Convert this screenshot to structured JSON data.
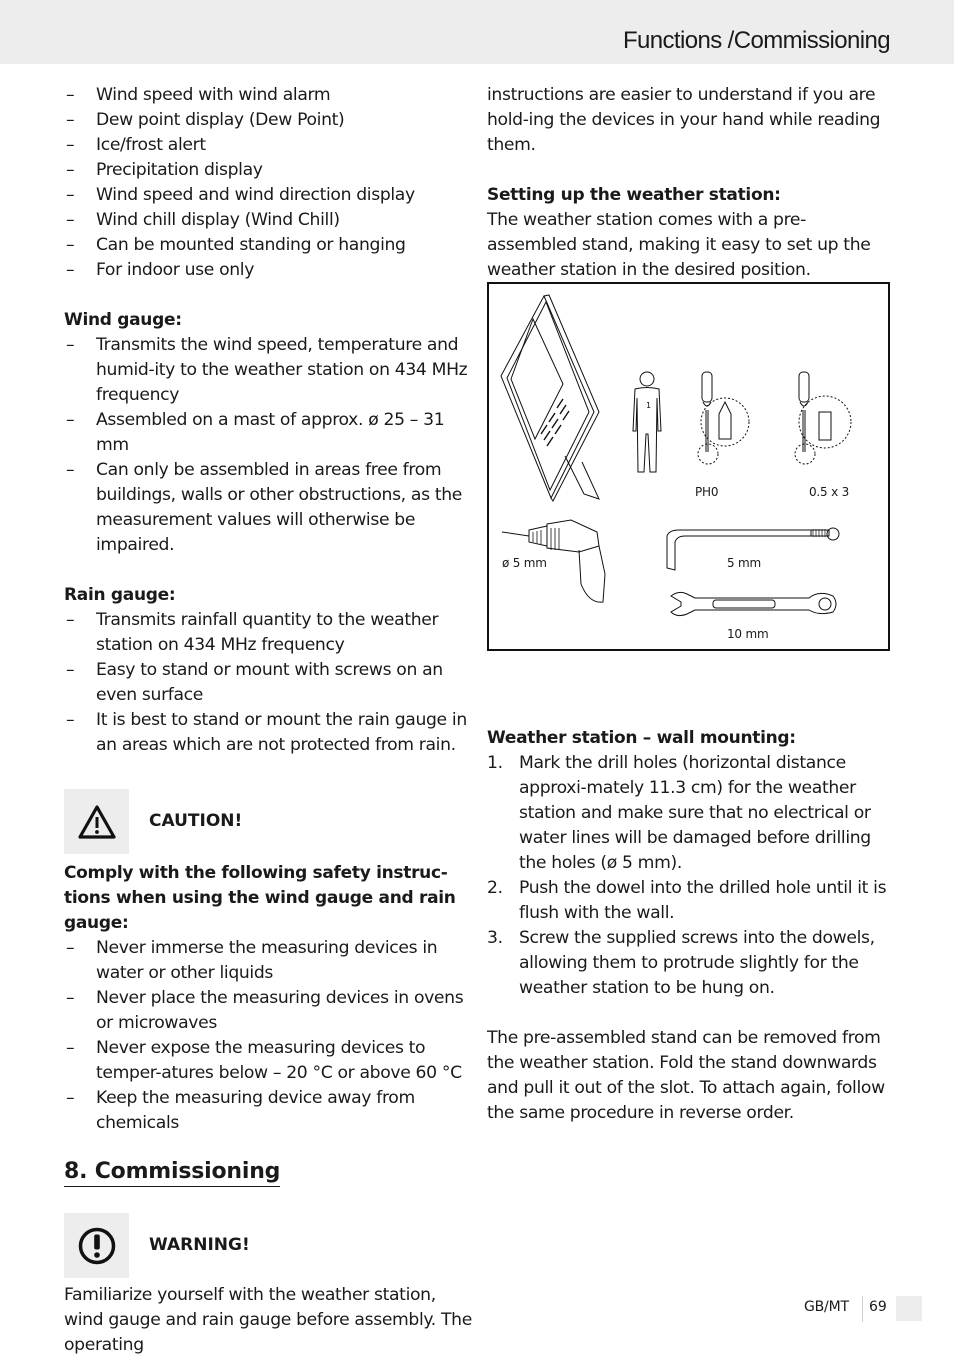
{
  "header": {
    "title": "Functions /Commissioning"
  },
  "left_column": {
    "feature_list": [
      "Wind speed with wind alarm",
      "Dew point display (Dew Point)",
      "Ice/frost alert",
      "Precipitation display",
      "Wind speed and wind direction display",
      "Wind chill display (Wind Chill)",
      "Can be mounted standing or hanging",
      "For indoor use only"
    ],
    "wind_gauge": {
      "heading": "Wind gauge:",
      "items": [
        "Transmits the wind speed, temperature and humid-ity to the weather station on 434 MHz frequency",
        "Assembled on a mast of approx. ø 25 – 31 mm",
        "Can only be assembled in areas free from buildings, walls or other obstructions, as the measurement values will otherwise be impaired."
      ]
    },
    "rain_gauge": {
      "heading": "Rain gauge:",
      "items": [
        "Transmits rainfall quantity to the weather station on 434 MHz frequency",
        "Easy to stand or mount with screws on an even surface",
        "It is best to stand or mount the rain gauge in an areas which are not protected from rain."
      ]
    },
    "caution": {
      "label": "CAUTION!",
      "icon": "warning-triangle-icon",
      "intro": "Comply with the following safety instruc-tions when using the wind gauge and rain gauge:",
      "items": [
        "Never immerse the measuring devices in water or other liquids",
        "Never place the measuring devices in ovens or microwaves",
        "Never expose the measuring devices to temper-atures below – 20 °C or above 60 °C",
        "Keep the measuring device away from chemicals"
      ]
    },
    "section": {
      "title": "8. Commissioning"
    },
    "warning": {
      "label": "WARNING!",
      "icon": "exclamation-circle-icon",
      "text": "Familiarize yourself with the weather station, wind gauge and rain gauge before assembly. The operating"
    }
  },
  "right_column": {
    "continued_text": "instructions are easier to understand if you are hold-ing the devices in your hand while reading them.",
    "setup": {
      "heading": "Setting up the weather station:",
      "text": "The weather station comes with a pre-assembled stand, making it easy to set up the weather station in the desired position."
    },
    "figure": {
      "person_count": "1",
      "labels": {
        "phillips": "PH0",
        "slotted": "0.5 x 3",
        "drill": "ø 5 mm",
        "hex_key": "5 mm",
        "wrench": "10 mm"
      }
    },
    "wall_mounting": {
      "heading": "Weather station – wall mounting:",
      "steps": [
        {
          "num": "1.",
          "text": "Mark the drill holes (horizontal distance approxi-mately 11.3 cm) for the weather station and make sure that no electrical or water lines will be damaged before drilling the holes (ø 5 mm)."
        },
        {
          "num": "2.",
          "text": "Push the dowel into the drilled hole until it is flush with the wall."
        },
        {
          "num": "3.",
          "text": "Screw the supplied screws into the dowels, allowing them to protrude slightly for the weather station to be hung on."
        }
      ],
      "closing": "The pre-assembled stand can be removed from the weather station. Fold the stand downwards and pull it out of the slot. To attach again, follow the same procedure in reverse order."
    }
  },
  "footer": {
    "lang": "GB/MT",
    "page": "69"
  }
}
